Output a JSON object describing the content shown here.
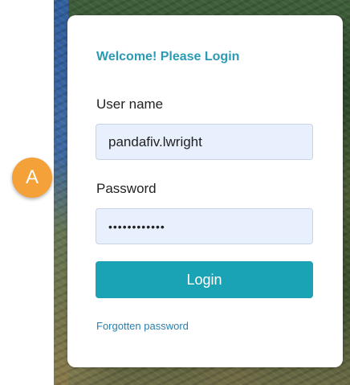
{
  "login": {
    "title": "Welcome! Please Login",
    "username_label": "User name",
    "username_value": "pandafiv.lwright",
    "password_label": "Password",
    "password_value": "••••••••••••",
    "login_button": "Login",
    "forgot_link": "Forgotten password"
  },
  "callout": {
    "label": "A",
    "color": "#f4a13a"
  },
  "colors": {
    "accent": "#1aa3b5",
    "title": "#2a9ab5",
    "link": "#2a7fb0",
    "field_bg": "#e8f0fe"
  }
}
